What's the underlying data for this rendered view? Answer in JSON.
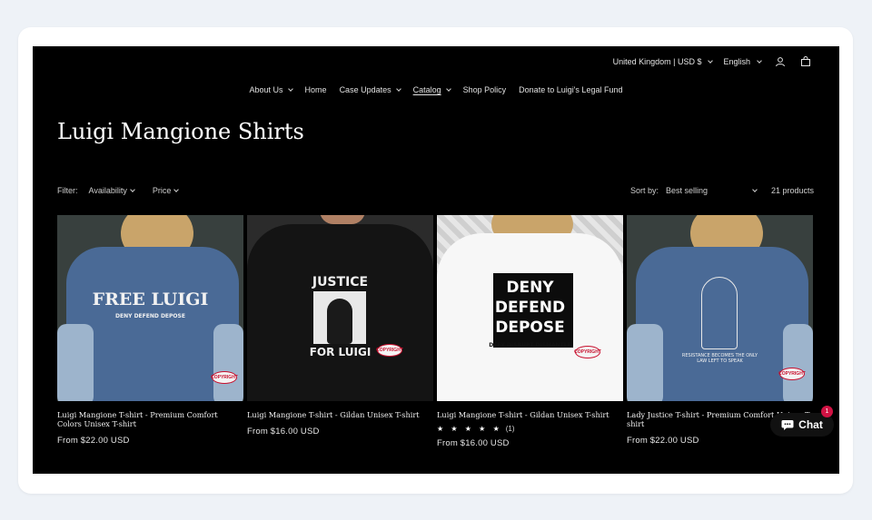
{
  "utility": {
    "locale": "United Kingdom | USD $",
    "language": "English"
  },
  "nav": {
    "items": [
      {
        "label": "About Us"
      },
      {
        "label": "Home"
      },
      {
        "label": "Case Updates"
      },
      {
        "label": "Catalog"
      },
      {
        "label": "Shop Policy"
      },
      {
        "label": "Donate to Luigi's Legal Fund"
      }
    ]
  },
  "page": {
    "title": "Luigi Mangione Shirts"
  },
  "filters": {
    "label": "Filter:",
    "availability": "Availability",
    "price": "Price",
    "sort_label": "Sort by:",
    "sort_value": "Best selling",
    "count": "21 products"
  },
  "products": [
    {
      "title": "Luigi Mangione T-shirt - Premium Comfort Colors Unisex T-shirt",
      "price": "From $22.00 USD",
      "print_line1": "FREE LUIGI",
      "print_line2": "DENY DEFEND DEPOSE",
      "stamp": "COPYRIGHT"
    },
    {
      "title": "Luigi Mangione T-shirt - Gildan Unisex T-shirt",
      "price": "From $16.00 USD",
      "print_line1": "JUSTICE",
      "print_line2": "FOR LUIGI",
      "stamp": "COPYRIGHT"
    },
    {
      "title": "Luigi Mangione T-shirt - Gildan Unisex T-shirt",
      "price": "From $16.00 USD",
      "rating_stars": "★ ★ ★ ★ ★",
      "rating_count": "(1)",
      "print_line1": "DENY",
      "print_line2": "DEFEND",
      "print_line3": "DEPOSE",
      "print_line4": "DEFY DISRUPT DISMANTLE",
      "stamp": "COPYRIGHT"
    },
    {
      "title": "Lady Justice T-shirt - Premium Comfort Unisex T-shirt",
      "price": "From $22.00 USD",
      "print_line1": "RESISTANCE BECOMES THE ONLY LAW LEFT TO SPEAK",
      "stamp": "COPYRIGHT"
    }
  ],
  "chat": {
    "label": "Chat",
    "badge": "1"
  },
  "colors": {
    "site_bg": "#000000",
    "frame_bg": "#eef2f7",
    "badge": "#d11243"
  }
}
